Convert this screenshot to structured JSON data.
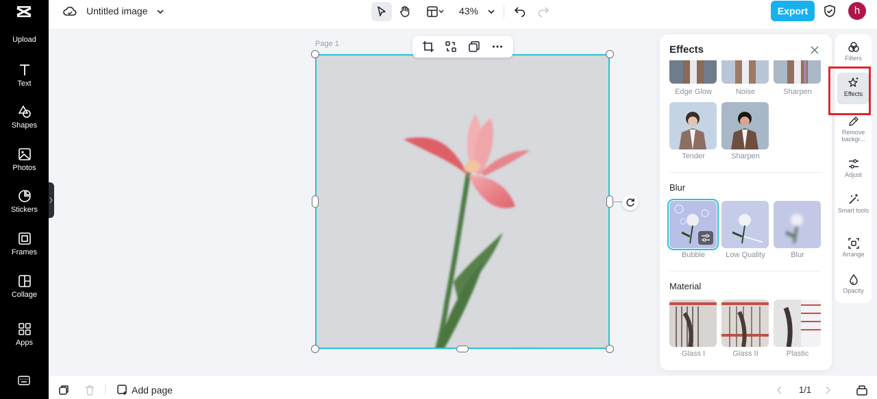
{
  "app": {
    "title": "Untitled image",
    "zoom": "43%",
    "export_label": "Export",
    "avatar_initial": "h"
  },
  "sidebar": {
    "items": [
      {
        "label": "Upload",
        "icon": "upload-icon"
      },
      {
        "label": "Text",
        "icon": "text-icon"
      },
      {
        "label": "Shapes",
        "icon": "shapes-icon"
      },
      {
        "label": "Photos",
        "icon": "photos-icon"
      },
      {
        "label": "Stickers",
        "icon": "stickers-icon"
      },
      {
        "label": "Frames",
        "icon": "frames-icon"
      },
      {
        "label": "Collage",
        "icon": "collage-icon"
      },
      {
        "label": "Apps",
        "icon": "apps-icon"
      }
    ]
  },
  "canvas": {
    "page_label": "Page 1"
  },
  "effects_panel": {
    "title": "Effects",
    "top_row": [
      "Edge Glow",
      "Noise",
      "Sharpen"
    ],
    "second_row": [
      "Tender",
      "Sharpen"
    ],
    "sections": [
      {
        "title": "Blur",
        "items": [
          "Bubble",
          "Low Quality",
          "Blur"
        ]
      },
      {
        "title": "Material",
        "items": [
          "Glass I",
          "Glass II",
          "Plastic"
        ]
      }
    ]
  },
  "right_rail": {
    "items": [
      {
        "label": "Filters",
        "icon": "filters-icon"
      },
      {
        "label": "Effects",
        "icon": "effects-icon",
        "active": true
      },
      {
        "label": "Remove backgr...",
        "icon": "remove-background-icon"
      },
      {
        "label": "Adjust",
        "icon": "adjust-icon"
      },
      {
        "label": "Smart tools",
        "icon": "smart-tools-icon"
      },
      {
        "label": "Arrange",
        "icon": "arrange-icon"
      },
      {
        "label": "Opacity",
        "icon": "opacity-icon"
      }
    ]
  },
  "bottom_bar": {
    "add_page_label": "Add page",
    "page_indicator": "1/1"
  },
  "colors": {
    "accent": "#18b1f0",
    "selection": "#27c1dc",
    "highlight": "#e2242a",
    "avatar": "#b0154a"
  }
}
